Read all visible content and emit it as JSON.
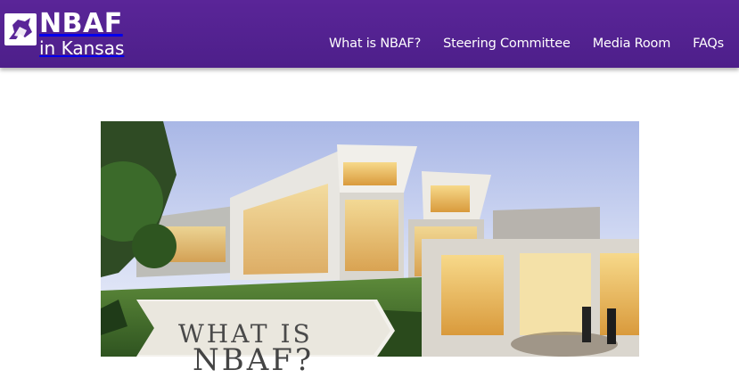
{
  "header": {
    "logo": {
      "line1": "NBAF",
      "line2": "in Kansas"
    },
    "nav": [
      {
        "label": "What is NBAF?"
      },
      {
        "label": "Steering Committee"
      },
      {
        "label": "Media Room"
      },
      {
        "label": "FAQs"
      }
    ]
  },
  "hero": {
    "banner_line1": "WHAT IS",
    "banner_line2": "NBAF?"
  },
  "colors": {
    "brand_purple": "#5a2598",
    "nav_text": "#ffffff"
  }
}
